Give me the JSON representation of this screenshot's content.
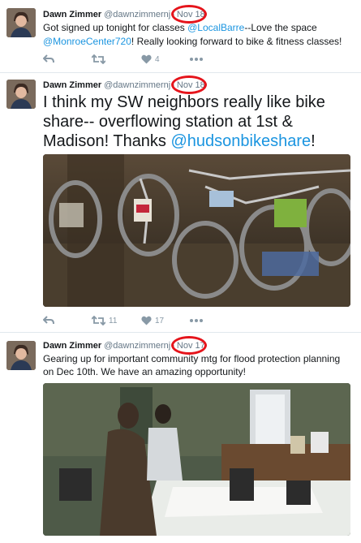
{
  "tweets": [
    {
      "author_name": "Dawn Zimmer",
      "author_handle": "@dawnzimmernj",
      "date": "Nov 18",
      "text_parts": [
        "Got signed up tonight for classes ",
        "@LocalBarre",
        "--Love the space ",
        "@MonroeCenter720",
        "!  Really looking forward to bike & fitness classes!"
      ],
      "reply_count": "",
      "retweet_count": "",
      "like_count": "4"
    },
    {
      "author_name": "Dawn Zimmer",
      "author_handle": "@dawnzimmernj",
      "date": "Nov 18",
      "text_parts": [
        "I think my SW neighbors really like bike share-- overflowing station at 1st & Madison!  Thanks ",
        "@hudsonbikeshare",
        "!"
      ],
      "reply_count": "",
      "retweet_count": "11",
      "like_count": "17"
    },
    {
      "author_name": "Dawn Zimmer",
      "author_handle": "@dawnzimmernj",
      "date": "Nov 17",
      "text_parts": [
        "Gearing up for important community mtg for flood protection planning on Dec 10th.  We have an amazing opportunity!"
      ],
      "reply_count": "",
      "retweet_count": "",
      "like_count": ""
    }
  ],
  "icons": {
    "reply": "reply-icon",
    "retweet": "retweet-icon",
    "like": "heart-icon",
    "more": "more-icon"
  },
  "colors": {
    "link": "#1b95e0",
    "annotation_circle": "#e5141b",
    "action_gray": "#8899a6"
  }
}
